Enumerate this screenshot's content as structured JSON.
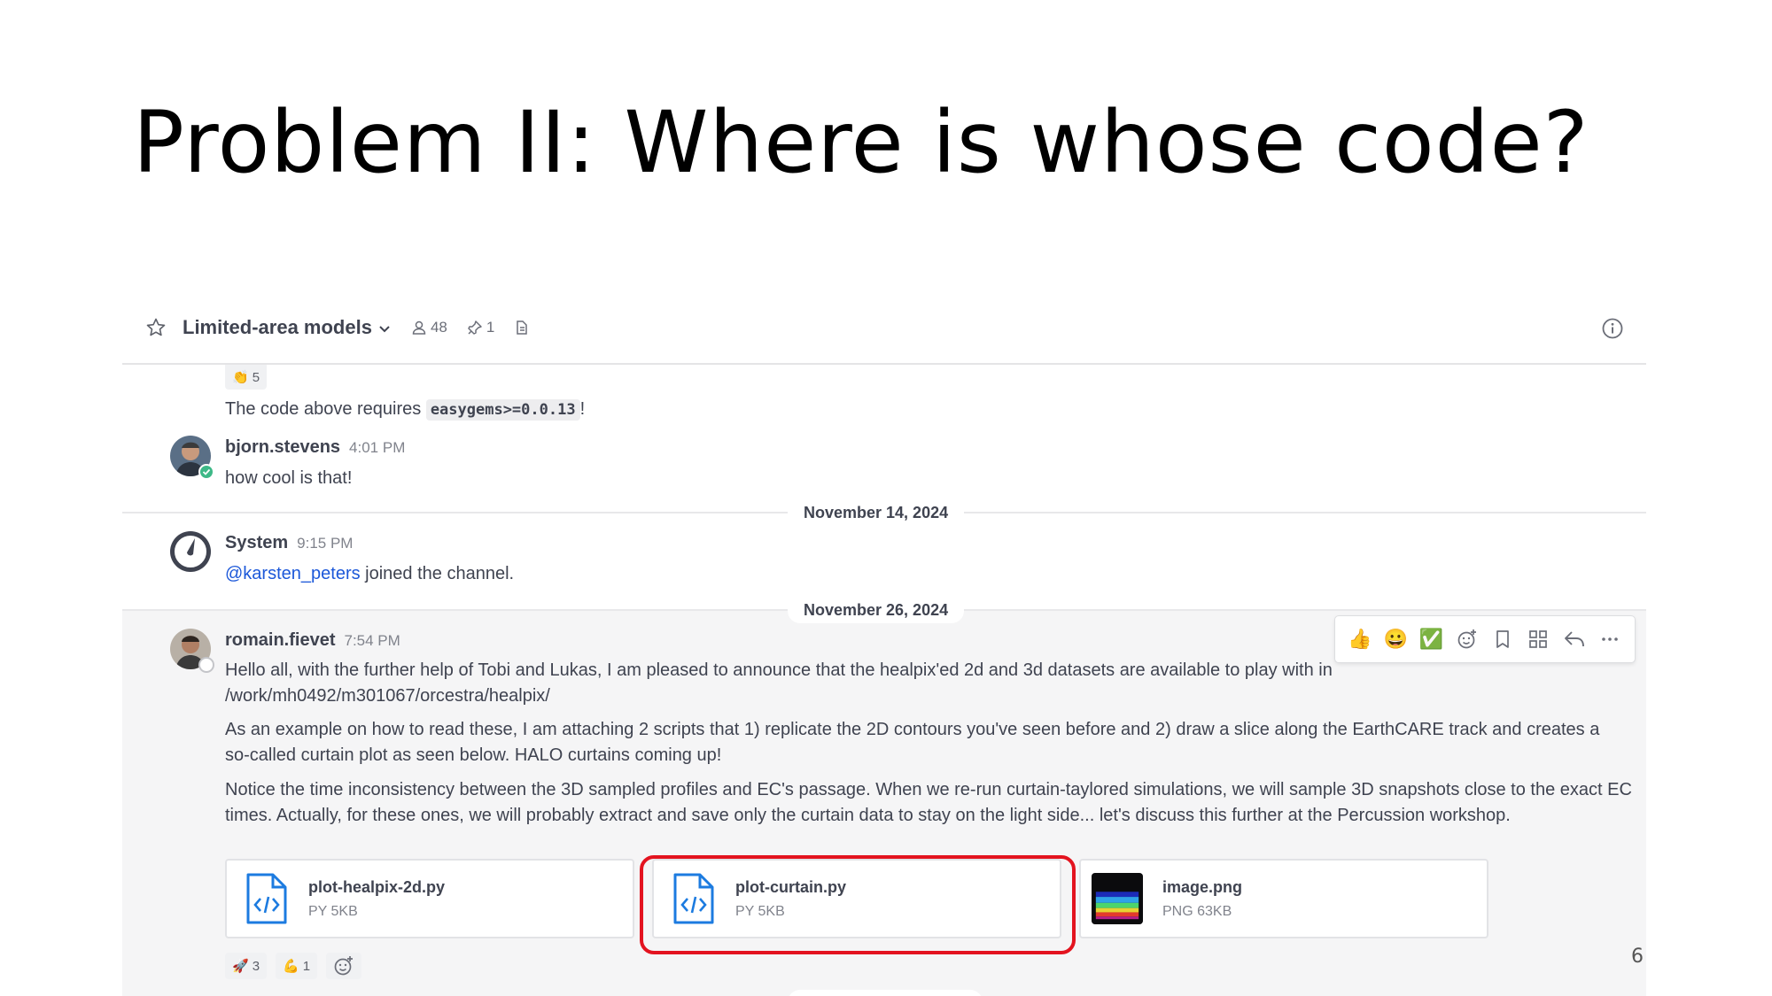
{
  "slide": {
    "title": "Problem II: Where is whose code?",
    "page_number": "6"
  },
  "channel": {
    "name": "Limited-area models",
    "member_count": "48",
    "pinned_count": "1"
  },
  "messages": {
    "top_reaction_count": "5",
    "prev_text_before": "The code above requires ",
    "prev_code": "easygems>=0.0.13",
    "prev_text_after": "!",
    "bjorn": {
      "author": "bjorn.stevens",
      "time": "4:01 PM",
      "text": "how cool is that!"
    },
    "date1": "November 14, 2024",
    "system": {
      "author": "System",
      "time": "9:15 PM",
      "mention": "@karsten_peters",
      "text": " joined the channel."
    },
    "date2": "November 26, 2024",
    "romain": {
      "author": "romain.fievet",
      "time": "7:54 PM",
      "p1": "Hello all, with the further help of Tobi and Lukas, I am pleased to announce that the healpix'ed 2d and 3d datasets are available to play with in /work/mh0492/m301067/orcestra/healpix/",
      "p2": "As an example on how to read these, I am attaching 2 scripts that 1) replicate the 2D contours you've seen before and 2) draw a slice along the EarthCARE track and creates a so-called curtain plot as seen below. HALO curtains coming up!",
      "p3": "Notice the time inconsistency between the 3D sampled profiles and EC's passage. When we re-run curtain-taylored simulations, we will sample 3D snapshots close to the exact EC times. Actually, for these ones, we will probably extract and save only the curtain data to stay on the light side... let's discuss this further at the Percussion workshop.",
      "attachments": [
        {
          "name": "plot-healpix-2d.py",
          "meta": "PY 5KB"
        },
        {
          "name": "plot-curtain.py",
          "meta": "PY 5KB"
        },
        {
          "name": "image.png",
          "meta": "PNG 63KB"
        }
      ],
      "reactions": [
        {
          "emoji": "🚀",
          "count": "3"
        },
        {
          "emoji": "💪",
          "count": "1"
        }
      ]
    }
  },
  "toolbar": {
    "emojis": [
      "👍",
      "😀",
      "✅"
    ]
  },
  "colors": {
    "highlight": "#e3131f",
    "mention": "#1c58d9",
    "file_icon": "#1c7be0"
  }
}
